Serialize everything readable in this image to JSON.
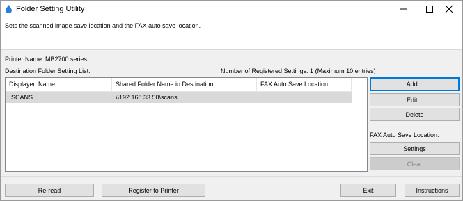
{
  "window": {
    "title": "Folder Setting Utility",
    "description": "Sets the scanned image save location and the FAX auto save location."
  },
  "printer": {
    "name_label": "Printer Name: MB2700 series"
  },
  "destination": {
    "list_label": "Destination Folder Setting List:",
    "count_label": "Number of Registered Settings: 1 (Maximum 10 entries)",
    "columns": [
      "Displayed Name",
      "Shared Folder Name in Destination",
      "FAX Auto Save Location"
    ],
    "rows": [
      {
        "name": "SCANS",
        "folder": "\\\\192.168.33.50\\scans",
        "fax": ""
      }
    ]
  },
  "side_buttons": {
    "add": "Add...",
    "edit": "Edit...",
    "delete": "Delete",
    "fax_label": "FAX Auto Save Location:",
    "settings": "Settings",
    "clear": "Clear"
  },
  "footer_buttons": {
    "reread": "Re-read",
    "register": "Register to Printer",
    "exit": "Exit",
    "instructions": "Instructions"
  },
  "colors": {
    "focus_border": "#0078d7",
    "selected_row": "#d9d9d9",
    "disabled_text": "#838383"
  },
  "icons": [
    "app-water-drop-icon",
    "minimize-icon",
    "maximize-icon",
    "close-icon"
  ]
}
